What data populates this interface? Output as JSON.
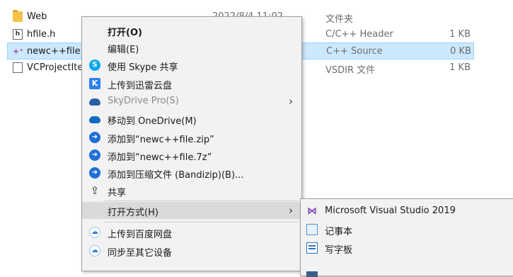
{
  "files": [
    {
      "icon": "folder-icon",
      "name": "Web",
      "date": "2022/8/4 11:02",
      "type": "文件夹",
      "size": ""
    },
    {
      "icon": "header-file-icon",
      "name": "hfile.h",
      "date": "",
      "type": "C/C++ Header",
      "size": "1 KB"
    },
    {
      "icon": "cpp-file-icon",
      "name": "newc++file.cpp",
      "date": "",
      "type": "C++ Source",
      "size": "0 KB"
    },
    {
      "icon": "document-icon",
      "name": "VCProjectItems.vsdir",
      "date": "",
      "type": "VSDIR 文件",
      "size": "1 KB"
    }
  ],
  "context_menu": {
    "items": [
      {
        "label": "打开(O)",
        "icon": ""
      },
      {
        "label": "编辑(E)",
        "icon": ""
      },
      {
        "label": "使用 Skype 共享",
        "icon": "skype-icon"
      },
      {
        "label": "上传到迅雷云盘",
        "icon": "xunlei-icon"
      },
      {
        "label": "SkyDrive Pro(S)",
        "icon": "skydrive-icon"
      },
      {
        "label": "移动到 OneDrive(M)",
        "icon": "onedrive-icon"
      },
      {
        "label": "添加到“newc++file.zip”",
        "icon": "bandizip-icon"
      },
      {
        "label": "添加到“newc++file.7z”",
        "icon": "bandizip-icon"
      },
      {
        "label": "添加到压缩文件 (Bandizip)(B)...",
        "icon": "bandizip-icon"
      },
      {
        "label": "共享",
        "icon": "share-icon"
      },
      {
        "label": "打开方式(H)",
        "icon": ""
      },
      {
        "label": "上传到百度网盘",
        "icon": "baidu-netdisk-icon"
      },
      {
        "label": "同步至其它设备",
        "icon": "baidu-netdisk-icon"
      }
    ]
  },
  "open_with_submenu": {
    "items": [
      {
        "label": "Microsoft Visual Studio 2019",
        "icon": "visual-studio-icon"
      },
      {
        "label": "记事本",
        "icon": "notepad-icon"
      },
      {
        "label": "写字板",
        "icon": "wordpad-icon"
      }
    ]
  },
  "colors": {
    "selection": "#cce8ff",
    "menu_bg": "#f2f2f2",
    "highlight": "#dadada"
  }
}
